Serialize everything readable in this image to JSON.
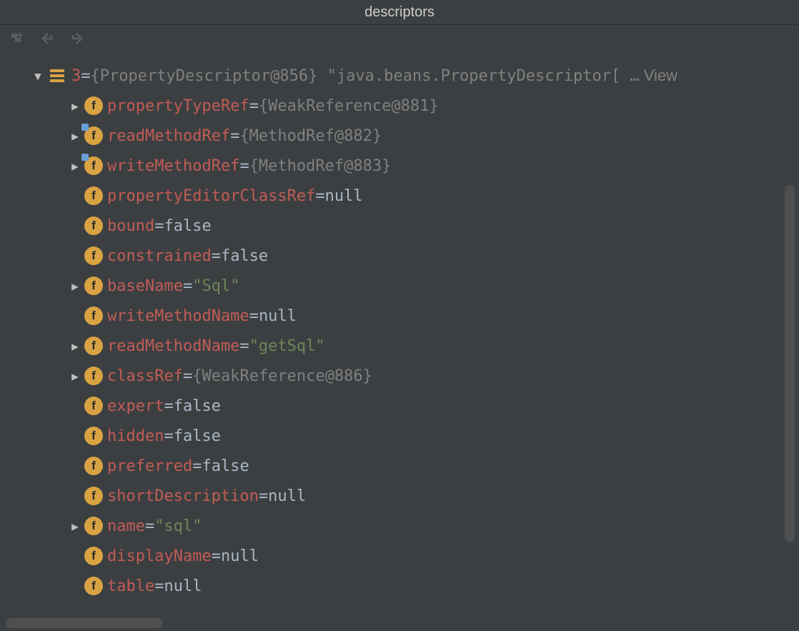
{
  "title": "descriptors",
  "root": {
    "key": "3",
    "value": "{PropertyDescriptor@856} \"java.beans.PropertyDescriptor[ …",
    "view_label": "View"
  },
  "fields": [
    {
      "key": "propertyTypeRef",
      "type": "obj",
      "value": "{WeakReference@881}",
      "expandable": true,
      "super": false
    },
    {
      "key": "readMethodRef",
      "type": "obj",
      "value": "{MethodRef@882}",
      "expandable": true,
      "super": true
    },
    {
      "key": "writeMethodRef",
      "type": "obj",
      "value": "{MethodRef@883}",
      "expandable": true,
      "super": true
    },
    {
      "key": "propertyEditorClassRef",
      "type": "kw",
      "value": "null",
      "expandable": false,
      "super": false
    },
    {
      "key": "bound",
      "type": "kw",
      "value": "false",
      "expandable": false,
      "super": false
    },
    {
      "key": "constrained",
      "type": "kw",
      "value": "false",
      "expandable": false,
      "super": false
    },
    {
      "key": "baseName",
      "type": "str",
      "value": "\"Sql\"",
      "expandable": true,
      "super": false
    },
    {
      "key": "writeMethodName",
      "type": "kw",
      "value": "null",
      "expandable": false,
      "super": false
    },
    {
      "key": "readMethodName",
      "type": "str",
      "value": "\"getSql\"",
      "expandable": true,
      "super": false
    },
    {
      "key": "classRef",
      "type": "obj",
      "value": "{WeakReference@886}",
      "expandable": true,
      "super": false
    },
    {
      "key": "expert",
      "type": "kw",
      "value": "false",
      "expandable": false,
      "super": false
    },
    {
      "key": "hidden",
      "type": "kw",
      "value": "false",
      "expandable": false,
      "super": false
    },
    {
      "key": "preferred",
      "type": "kw",
      "value": "false",
      "expandable": false,
      "super": false
    },
    {
      "key": "shortDescription",
      "type": "kw",
      "value": "null",
      "expandable": false,
      "super": false
    },
    {
      "key": "name",
      "type": "str",
      "value": "\"sql\"",
      "expandable": true,
      "super": false
    },
    {
      "key": "displayName",
      "type": "kw",
      "value": "null",
      "expandable": false,
      "super": false
    },
    {
      "key": "table",
      "type": "kw",
      "value": "null",
      "expandable": false,
      "super": false
    }
  ]
}
